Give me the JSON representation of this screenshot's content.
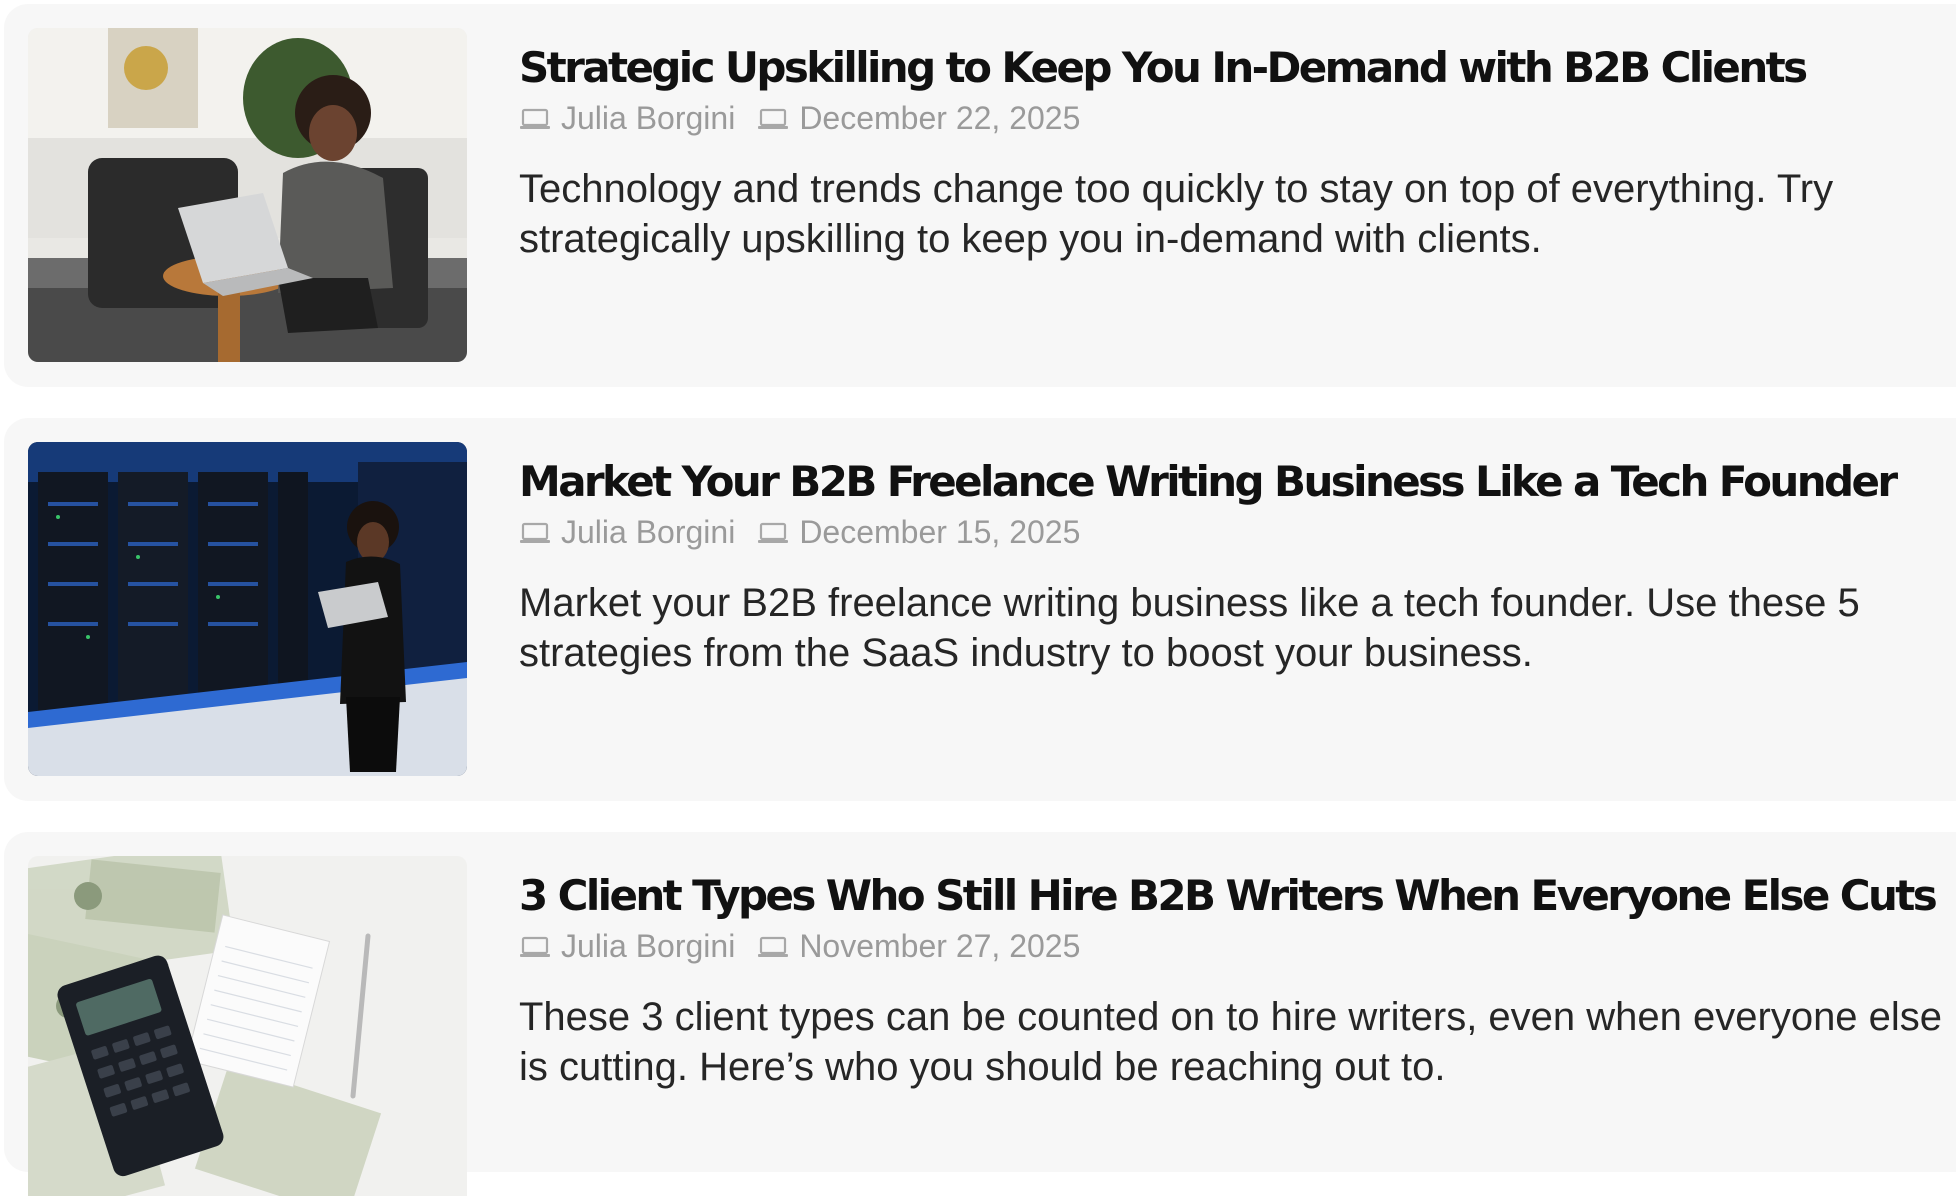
{
  "posts": [
    {
      "title": "Strategic Upskilling to Keep You In-Demand with B2B Clients",
      "author": "Julia Borgini",
      "date": "December 22, 2025",
      "excerpt": "Technology and trends change too quickly to stay on top of everything. Try strategically upskilling to keep you in-demand with clients.",
      "image": "woman-laptop-chair-photo"
    },
    {
      "title": "Market Your B2B Freelance Writing Business Like a Tech Founder",
      "author": "Julia Borgini",
      "date": "December 15, 2025",
      "excerpt": "Market your B2B freelance writing business like a tech founder. Use these 5 strategies from the SaaS industry to boost your business.",
      "image": "woman-server-room-photo"
    },
    {
      "title": "3 Client Types Who Still Hire B2B Writers When Everyone Else Cuts",
      "author": "Julia Borgini",
      "date": "November 27, 2025",
      "excerpt": "These 3 client types can be counted on to hire writers, even when everyone else is cutting. Here’s who you should be reaching out to.",
      "image": "money-calculator-notepad-photo"
    }
  ],
  "icons": {
    "author": "laptop-icon",
    "date": "laptop-icon"
  },
  "colors": {
    "card_background": "#f7f7f7",
    "title": "#111111",
    "meta": "#9a9a9a",
    "excerpt": "#262626"
  }
}
